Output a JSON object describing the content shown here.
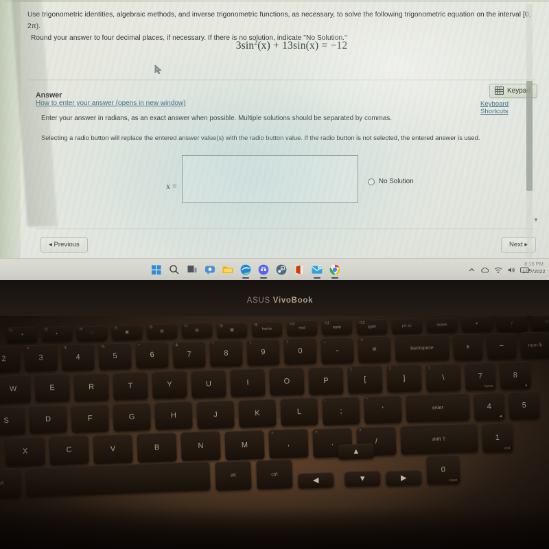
{
  "screen": {
    "question": {
      "line1": "Use trigonometric identities, algebraic methods, and inverse trigonometric functions, as necessary, to solve the following trigonometric equation on the interval [0, 2π).",
      "line2": "Round your answer to four decimal places, if necessary. If there is no solution, indicate \"No Solution.\"",
      "equation_lhs_a": "3sin",
      "equation_exponent": "2",
      "equation_lhs_b": "(x) + 13sin(x)",
      "equation_rhs": "= −12",
      "equation_plain": "3sin²(x) + 13sin(x) = −12"
    },
    "answer_section": {
      "title": "Answer",
      "help_link": "How to enter your answer (opens in new window)",
      "keypad_button": "Keypad",
      "keypad_icon": "keypad-icon",
      "keyboard_shortcuts": "Keyboard Shortcuts",
      "instruction_1": "Enter your answer in radians, as an exact answer when possible. Multiple solutions should be separated by commas.",
      "instruction_2": "Selecting a radio button will replace the entered answer value(s) with the radio button value. If the radio button is not selected, the entered answer is used.",
      "x_label": "x =",
      "answer_value": "",
      "answer_placeholder": "",
      "no_solution_label": "No Solution",
      "no_solution_selected": false
    },
    "navigation": {
      "previous": "◂ Previous",
      "next": "Next ▸"
    }
  },
  "taskbar": {
    "icons": [
      {
        "name": "start-icon",
        "label": "Start"
      },
      {
        "name": "search-icon",
        "label": "Search"
      },
      {
        "name": "task-view-icon",
        "label": "Task View"
      },
      {
        "name": "chat-icon",
        "label": "Chat"
      },
      {
        "name": "file-explorer-icon",
        "label": "File Explorer"
      },
      {
        "name": "edge-icon",
        "label": "Microsoft Edge"
      },
      {
        "name": "discord-icon",
        "label": "Discord"
      },
      {
        "name": "steam-icon",
        "label": "Steam"
      },
      {
        "name": "office-icon",
        "label": "Office"
      },
      {
        "name": "mail-icon",
        "label": "Mail"
      },
      {
        "name": "chrome-icon",
        "label": "Google Chrome"
      }
    ],
    "tray": [
      {
        "name": "show-hidden-icons-icon"
      },
      {
        "name": "onedrive-icon"
      },
      {
        "name": "wifi-icon"
      },
      {
        "name": "volume-icon"
      },
      {
        "name": "battery-icon"
      }
    ],
    "clock": {
      "time": "8:16 PM",
      "date": "1/27/2022"
    }
  },
  "laptop": {
    "brand_prefix": "ASUS ",
    "brand_suffix": "VivoBook"
  },
  "keyboard": {
    "function_row": [
      {
        "label": "◂",
        "sub": "f1"
      },
      {
        "label": "▸",
        "sub": "f2"
      },
      {
        "label": "□",
        "sub": "f4"
      },
      {
        "label": "▣",
        "sub": "f5"
      },
      {
        "label": "▤",
        "sub": "f6"
      },
      {
        "label": "▥",
        "sub": "f7"
      },
      {
        "label": "▦",
        "sub": "f8"
      },
      {
        "label": "home",
        "sub": "f9"
      },
      {
        "label": "end",
        "sub": "f10"
      },
      {
        "label": "pgup",
        "sub": "f11"
      },
      {
        "label": "pgdn",
        "sub": "f12"
      },
      {
        "label": "prt sc",
        "sub": ""
      },
      {
        "label": "delete",
        "sub": ""
      },
      {
        "label": "☀",
        "sub": ""
      },
      {
        "label": "/",
        "sub": ""
      },
      {
        "label": "⏻",
        "sub": ""
      }
    ],
    "number_row": [
      {
        "label": "2",
        "sub": "@"
      },
      {
        "label": "3",
        "sub": "#"
      },
      {
        "label": "4",
        "sub": "$"
      },
      {
        "label": "5",
        "sub": "%"
      },
      {
        "label": "6",
        "sub": "^"
      },
      {
        "label": "7",
        "sub": "&"
      },
      {
        "label": "8",
        "sub": "*"
      },
      {
        "label": "9",
        "sub": "("
      },
      {
        "label": "0",
        "sub": ")"
      },
      {
        "label": "-",
        "sub": "_"
      },
      {
        "label": "=",
        "sub": "+"
      },
      {
        "label": "backspace",
        "sub": ""
      },
      {
        "label": "+",
        "sub": ""
      },
      {
        "label": "−",
        "sub": ""
      },
      {
        "label": "num lk",
        "sub": ""
      }
    ],
    "top_letter_row": [
      {
        "label": "W",
        "sub": ""
      },
      {
        "label": "E",
        "sub": ""
      },
      {
        "label": "R",
        "sub": ""
      },
      {
        "label": "T",
        "sub": ""
      },
      {
        "label": "Y",
        "sub": ""
      },
      {
        "label": "U",
        "sub": ""
      },
      {
        "label": "I",
        "sub": ""
      },
      {
        "label": "O",
        "sub": ""
      },
      {
        "label": "P",
        "sub": ""
      },
      {
        "label": "[",
        "sub": "{"
      },
      {
        "label": "]",
        "sub": "}"
      },
      {
        "label": "\\",
        "sub": "|"
      },
      {
        "label": "7",
        "sub": "",
        "tiny": "home"
      },
      {
        "label": "8",
        "sub": "",
        "tiny": "▲"
      }
    ],
    "home_row": [
      {
        "label": "S",
        "sub": ""
      },
      {
        "label": "D",
        "sub": ""
      },
      {
        "label": "F",
        "sub": ""
      },
      {
        "label": "G",
        "sub": ""
      },
      {
        "label": "H",
        "sub": ""
      },
      {
        "label": "J",
        "sub": ""
      },
      {
        "label": "K",
        "sub": ""
      },
      {
        "label": "L",
        "sub": ""
      },
      {
        "label": ";",
        "sub": ":"
      },
      {
        "label": "'",
        "sub": "\""
      },
      {
        "label": "enter",
        "sub": ""
      },
      {
        "label": "4",
        "sub": "",
        "tiny": "◀"
      },
      {
        "label": "5",
        "sub": ""
      }
    ],
    "bottom_letter_row": [
      {
        "label": "X",
        "sub": ""
      },
      {
        "label": "C",
        "sub": ""
      },
      {
        "label": "V",
        "sub": ""
      },
      {
        "label": "B",
        "sub": ""
      },
      {
        "label": "N",
        "sub": ""
      },
      {
        "label": "M",
        "sub": ""
      },
      {
        "label": ",",
        "sub": "<"
      },
      {
        "label": ".",
        "sub": ">"
      },
      {
        "label": "/",
        "sub": "?"
      },
      {
        "label": "shift ⇧",
        "sub": ""
      },
      {
        "label": "1",
        "sub": "",
        "tiny": "end"
      }
    ],
    "modifier_row": [
      {
        "label": "ctrl",
        "sub": ""
      },
      {
        "label": "",
        "sub": ""
      },
      {
        "label": "alt",
        "sub": ""
      },
      {
        "label": "ctrl",
        "sub": ""
      },
      {
        "label": "◀",
        "sub": ""
      },
      {
        "label": "▲",
        "sub": ""
      },
      {
        "label": "▼",
        "sub": ""
      },
      {
        "label": "▶",
        "sub": ""
      },
      {
        "label": "0",
        "sub": "",
        "tiny": "insert"
      }
    ]
  },
  "colors": {
    "link": "#3d6f86",
    "text": "#30353a",
    "keypad_bg": "#dbe2d2",
    "key_cap": "#221910",
    "deck": "#4a3525"
  }
}
